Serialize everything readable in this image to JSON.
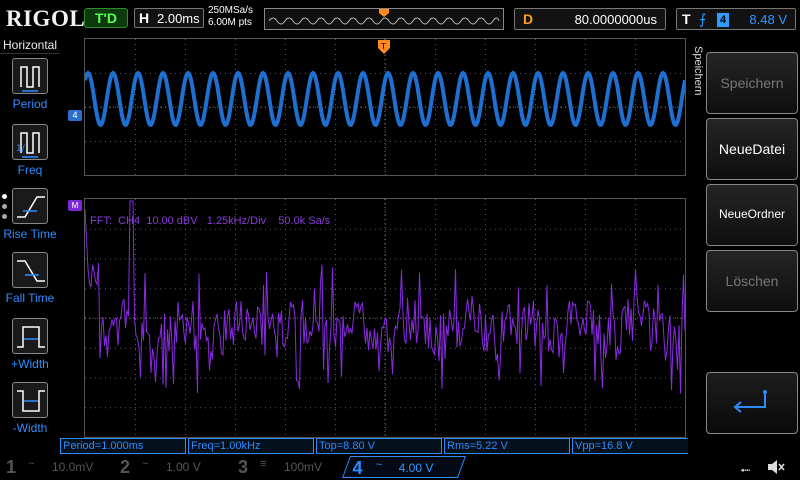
{
  "header": {
    "logo": "RIGOL",
    "trigger_status": "T'D",
    "timebase_label": "H",
    "timebase_value": "2.00ms",
    "sample_rate": "250MSa/s",
    "memory_depth": "6.00M pts",
    "delay_label": "D",
    "delay_value": "80.0000000us",
    "trigger_label": "T",
    "trigger_source": "4",
    "trigger_level": "8.48 V"
  },
  "left_menu": {
    "title": "Horizontal",
    "items": [
      {
        "label": "Period",
        "icon": "period-icon"
      },
      {
        "label": "Freq",
        "icon": "freq-icon"
      },
      {
        "label": "Rise Time",
        "icon": "rise-time-icon"
      },
      {
        "label": "Fall Time",
        "icon": "fall-time-icon"
      },
      {
        "label": "+Width",
        "icon": "pos-width-icon"
      },
      {
        "label": "-Width",
        "icon": "neg-width-icon"
      }
    ]
  },
  "waveform": {
    "channel_marker": "4",
    "math_marker": "M",
    "fft_info": "FFT:  CH4  10.00 dBV   1.25kHz/Div    50.0k Sa/s",
    "color_ch4": "#1f6fd1",
    "color_fft": "#8a2be2"
  },
  "measurements": [
    {
      "text": "Period=1.000ms"
    },
    {
      "text": "Freq=1.00kHz"
    },
    {
      "text": "Top=8.80 V"
    },
    {
      "text": "Rms=5.22 V"
    },
    {
      "text": "Vpp=16.8 V"
    }
  ],
  "right_menu": {
    "title": "Speichern",
    "buttons": [
      {
        "label": "Speichern",
        "enabled": false
      },
      {
        "label": "NeueDatei",
        "enabled": true
      },
      {
        "label": "NeueOrdner",
        "enabled": true
      },
      {
        "label": "Löschen",
        "enabled": false
      }
    ],
    "enter_icon": "enter-icon"
  },
  "channels": [
    {
      "num": "1",
      "coupling": "~",
      "scale": "10.0mV"
    },
    {
      "num": "2",
      "coupling": "~",
      "scale": "1.00 V"
    },
    {
      "num": "3",
      "coupling": "≡",
      "scale": "100mV"
    },
    {
      "num": "4",
      "coupling": "~",
      "scale": "4.00 V"
    }
  ]
}
